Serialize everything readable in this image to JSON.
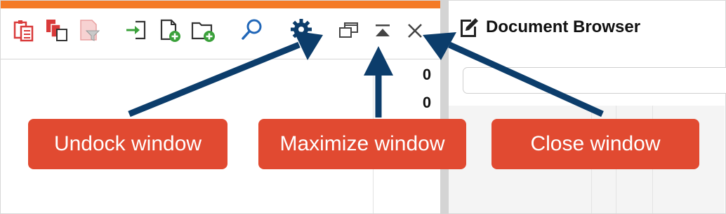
{
  "toolbar": {
    "icons": [
      "clipboard-icon",
      "copy-icon",
      "filter-icon",
      "import-icon",
      "new-document-icon",
      "new-folder-icon",
      "search-icon",
      "settings-gear-icon",
      "undock-window-icon",
      "maximize-window-icon",
      "close-window-icon"
    ]
  },
  "list": {
    "values": [
      "0",
      "0"
    ]
  },
  "document_browser": {
    "title": "Document Browser",
    "icon": "edit-document-icon"
  },
  "callouts": {
    "undock": "Undock window",
    "maximize": "Maximize window",
    "close": "Close window"
  },
  "colors": {
    "accent_orange": "#f47a27",
    "callout_red": "#e14a31",
    "arrow_navy": "#0c3d6b",
    "icon_red": "#d93a3a",
    "icon_green": "#3ba13b",
    "icon_blue": "#2167b8"
  }
}
